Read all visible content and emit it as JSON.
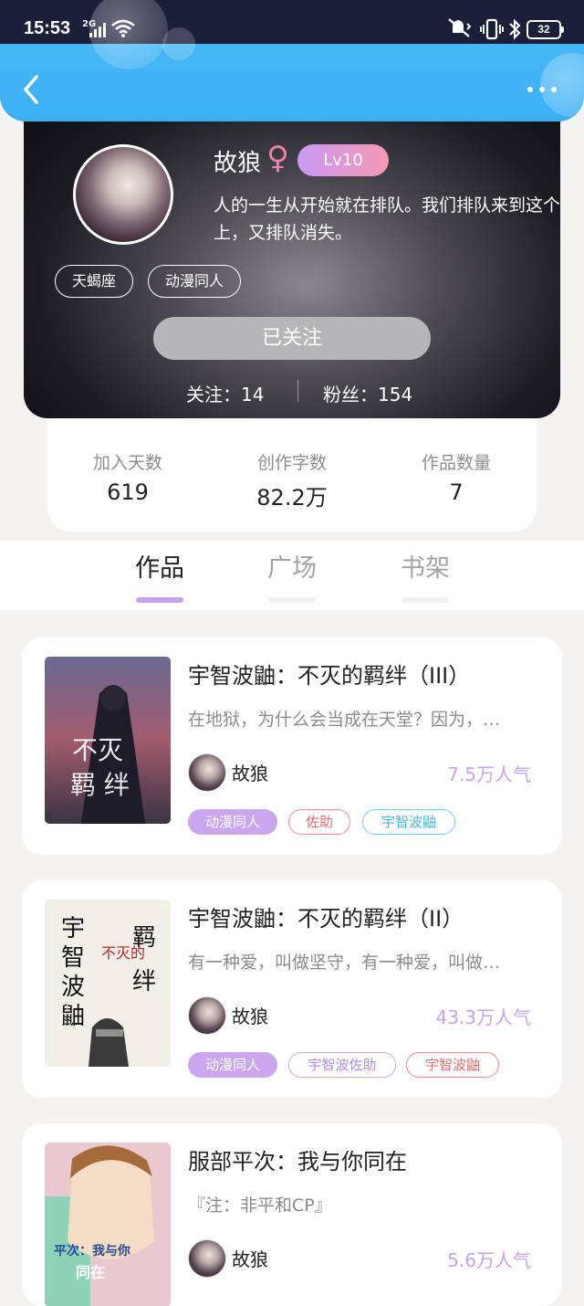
{
  "status_bar": {
    "time": "15:53",
    "network": "2G",
    "battery": "32"
  },
  "header": {
    "back_icon": "chevron-left-icon",
    "more_icon": "more-dots-icon"
  },
  "profile": {
    "name": "故狼",
    "gender_icon": "♀",
    "level": "Lv10",
    "bio_line1": "人的一生从开始就在排队。我们排队来到这个",
    "bio_line2": "上，又排队消失。",
    "tags": [
      "天蝎座",
      "动漫同人"
    ],
    "follow_button": "已关注",
    "following_label": "关注：",
    "following_count": "14",
    "fans_label": "粉丝：",
    "fans_count": "154"
  },
  "stats": [
    {
      "label": "加入天数",
      "value": "619"
    },
    {
      "label": "创作字数",
      "value": "82.2万"
    },
    {
      "label": "作品数量",
      "value": "7"
    }
  ],
  "tabs": [
    {
      "label": "作品",
      "active": true
    },
    {
      "label": "广场",
      "active": false
    },
    {
      "label": "书架",
      "active": false
    }
  ],
  "books": [
    {
      "title": "宇智波鼬：不灭的羁绊（III）",
      "desc": "在地狱，为什么会当成在天堂？因为，…",
      "author": "故狼",
      "popularity": "7.5万人气",
      "tags": [
        {
          "text": "动漫同人",
          "style": "fill"
        },
        {
          "text": "佐助",
          "style": "red"
        },
        {
          "text": "宇智波鼬",
          "style": "blue"
        }
      ]
    },
    {
      "title": "宇智波鼬：不灭的羁绊（II）",
      "desc": "有一种爱，叫做坚守，有一种爱，叫做…",
      "author": "故狼",
      "popularity": "43.3万人气",
      "tags": [
        {
          "text": "动漫同人",
          "style": "fill"
        },
        {
          "text": "宇智波佐助",
          "style": "purple"
        },
        {
          "text": "宇智波鼬",
          "style": "red"
        }
      ]
    },
    {
      "title": "服部平次：我与你同在",
      "desc": "『注：非平和CP』",
      "author": "故狼",
      "popularity": "5.6万人气",
      "tags": []
    }
  ]
}
